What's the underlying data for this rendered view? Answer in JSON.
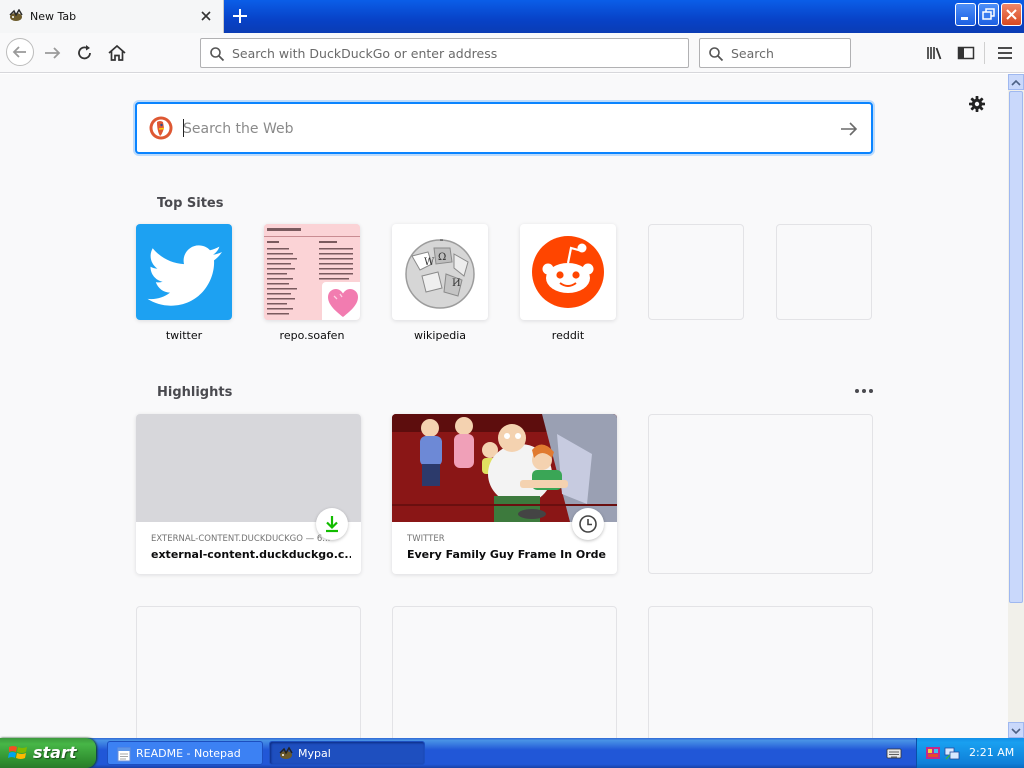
{
  "browser": {
    "tab": {
      "title": "New Tab"
    },
    "urlbar": {
      "placeholder": "Search with DuckDuckGo or enter address"
    },
    "searchbar": {
      "placeholder": "Search"
    }
  },
  "newtab": {
    "websearch": {
      "placeholder": "Search the Web"
    },
    "top_sites": {
      "title": "Top Sites",
      "sites": [
        {
          "label": "twitter",
          "icon": "twitter-bird-icon",
          "color": "#1da1f2"
        },
        {
          "label": "repo.soafen",
          "icon": "repo-screenshot-thumbnail",
          "color": "#fbd3d6"
        },
        {
          "label": "wikipedia",
          "icon": "wikipedia-globe-icon",
          "color": "#ffffff"
        },
        {
          "label": "reddit",
          "icon": "reddit-alien-icon",
          "color": "#ff4500"
        },
        {
          "label": ""
        },
        {
          "label": ""
        }
      ]
    },
    "highlights": {
      "title": "Highlights",
      "cards": [
        {
          "context": "EXTERNAL-CONTENT.DUCKDUCKGO — 6...",
          "title": "external-content.duckduckgo.c...",
          "badge_icon": "download-icon"
        },
        {
          "context": "TWITTER",
          "title": "Every Family Guy Frame In Orde...",
          "badge_icon": "clock-icon"
        }
      ]
    }
  },
  "taskbar": {
    "start_label": "start",
    "tasks": [
      {
        "label": "README - Notepad",
        "icon": "notepad-icon"
      },
      {
        "label": "Mypal",
        "icon": "mypal-icon"
      }
    ],
    "clock": "2:21 AM"
  },
  "colors": {
    "accent": "#0a84ff",
    "xp_taskbar": "#2157d7",
    "start_green": "#3c9a3c",
    "download_green": "#12bc00"
  }
}
